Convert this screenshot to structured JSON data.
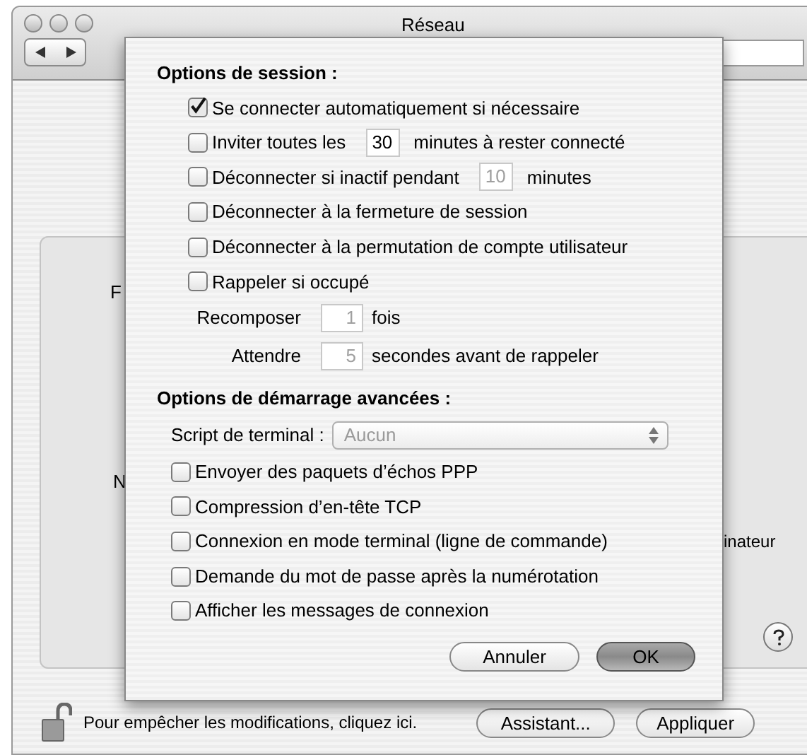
{
  "window": {
    "title": "Réseau"
  },
  "background": {
    "cut_labels": [
      "F",
      "N"
    ],
    "cut_note": "inateur"
  },
  "sheet": {
    "session_heading": "Options de session :",
    "session_options": [
      {
        "kind": "check",
        "label": "Se connecter automatiquement si nécessaire",
        "checked": true
      },
      {
        "kind": "check_field",
        "before": "Inviter toutes les",
        "value": "30",
        "after": "minutes à rester connecté",
        "checked": false,
        "field_disabled": false
      },
      {
        "kind": "check_field",
        "before": "Déconnecter si inactif pendant",
        "value": "10",
        "after": "minutes",
        "checked": false,
        "field_disabled": true
      },
      {
        "kind": "check",
        "label": "Déconnecter à la fermeture de session",
        "checked": false
      },
      {
        "kind": "check",
        "label": "Déconnecter à la permutation de compte utilisateur",
        "checked": false
      },
      {
        "kind": "check",
        "label": "Rappeler si occupé",
        "checked": false
      },
      {
        "kind": "field",
        "before": "Recomposer",
        "value": "1",
        "after": "fois",
        "field_disabled": true
      },
      {
        "kind": "field",
        "before": "Attendre",
        "value": "5",
        "after": "secondes avant de rappeler",
        "field_disabled": true
      }
    ],
    "advanced_heading": "Options de démarrage avancées :",
    "terminal_script": {
      "label": "Script de terminal :",
      "value": "Aucun",
      "disabled": true
    },
    "advanced_options": [
      {
        "label": "Envoyer des paquets d’échos PPP",
        "checked": false
      },
      {
        "label": "Compression d’en-tête TCP",
        "checked": false
      },
      {
        "label": "Connexion en mode terminal (ligne de commande)",
        "checked": false
      },
      {
        "label": "Demande du mot de passe après la numérotation",
        "checked": false
      },
      {
        "label": "Afficher les messages de connexion",
        "checked": false
      }
    ],
    "buttons": [
      {
        "label": "Annuler",
        "default": false
      },
      {
        "label": "OK",
        "default": true
      }
    ]
  },
  "footer": {
    "lock_text": "Pour empêcher les modifications, cliquez ici.",
    "buttons": [
      "Assistant...",
      "Appliquer"
    ]
  }
}
